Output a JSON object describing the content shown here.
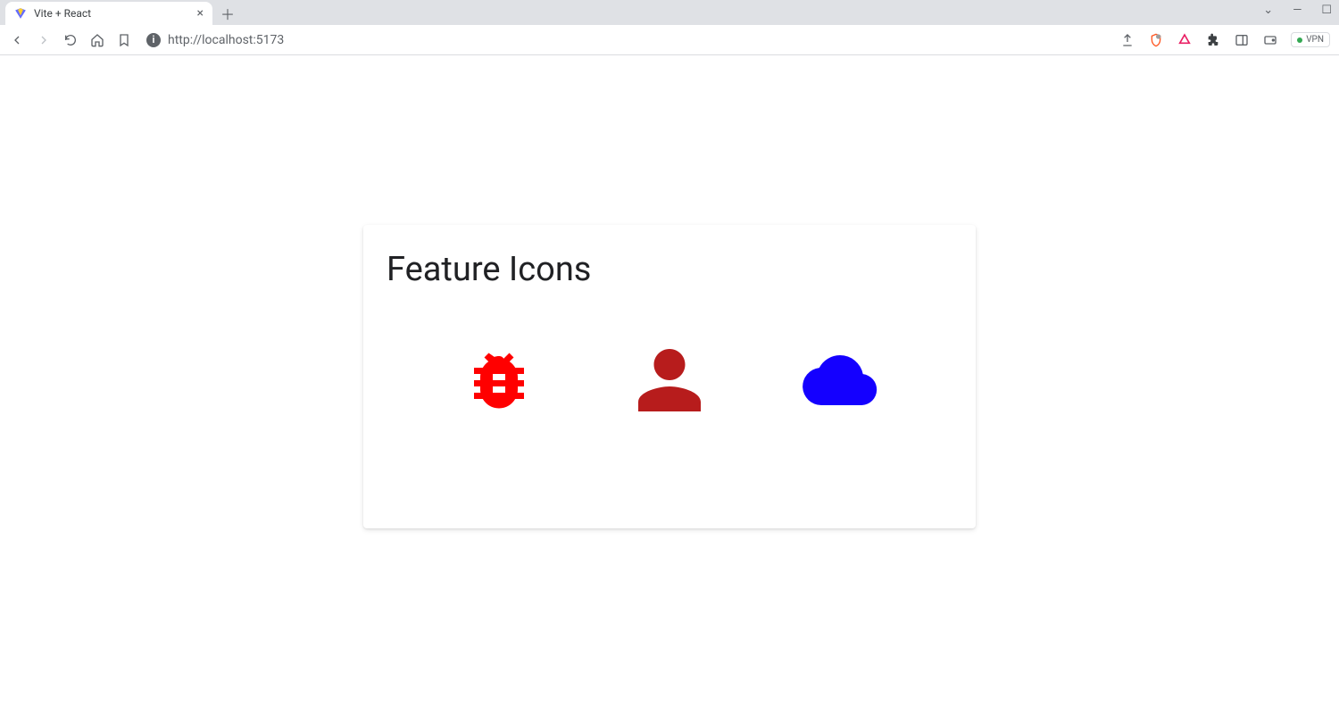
{
  "browser": {
    "tab_title": "Vite + React",
    "url": "http://localhost:5173",
    "vpn_label": "VPN"
  },
  "page": {
    "card_title": "Feature Icons",
    "icons": [
      {
        "name": "bug-report-icon",
        "color": "#ff0000"
      },
      {
        "name": "person-icon",
        "color": "#b71c1c"
      },
      {
        "name": "cloud-icon",
        "color": "#1400ff"
      }
    ]
  }
}
